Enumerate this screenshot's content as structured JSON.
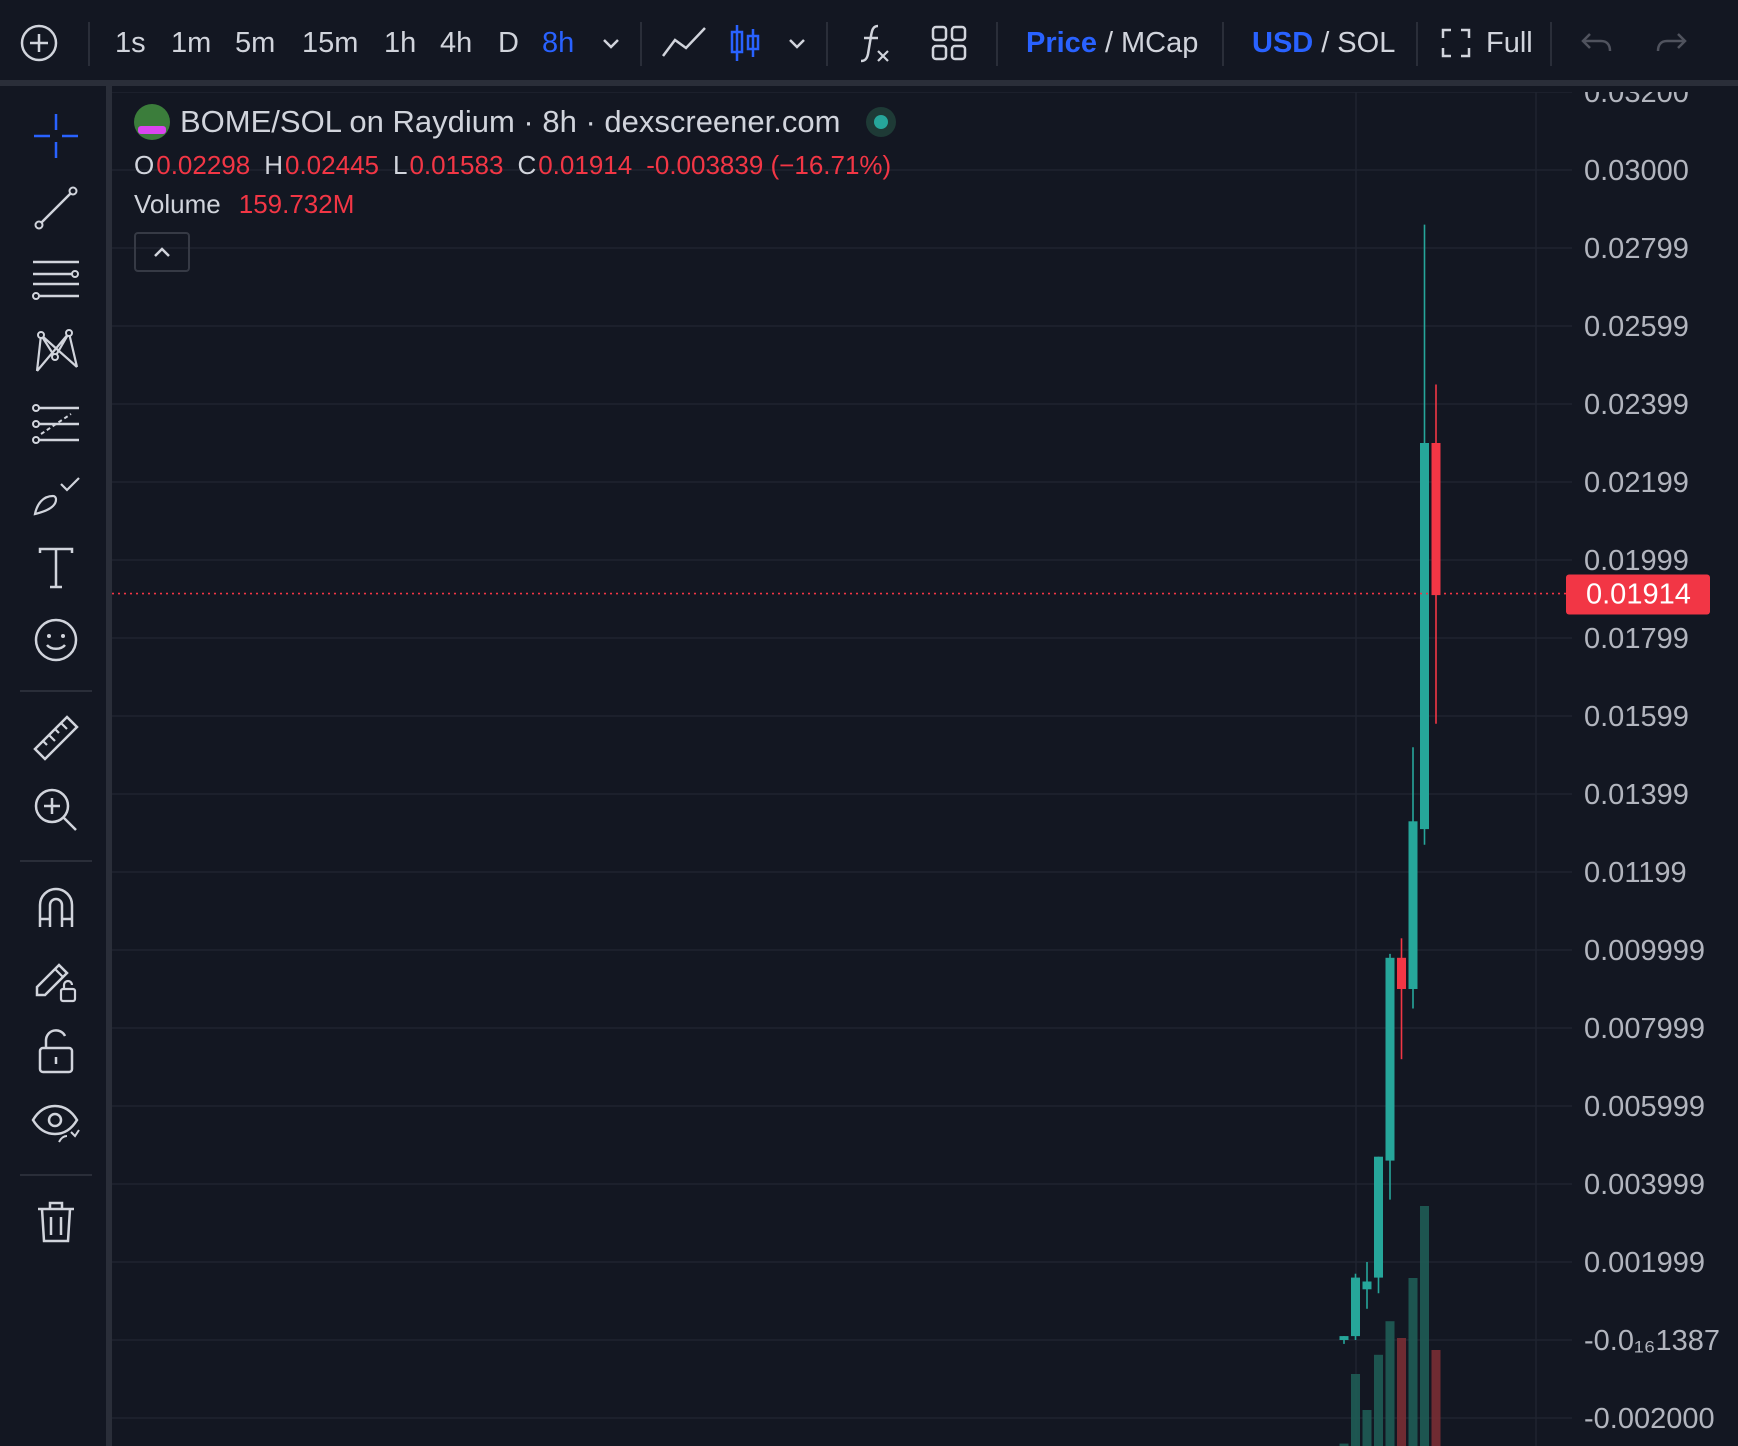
{
  "toolbar": {
    "intervals": [
      "1s",
      "1m",
      "5m",
      "15m",
      "1h",
      "4h",
      "D",
      "8h"
    ],
    "active_interval": "8h",
    "price_label": "Price",
    "mcap_label": "MCap",
    "usd_label": "USD",
    "sol_label": "SOL",
    "separator": "/",
    "full_label": "Full"
  },
  "legend": {
    "title": "BOME/SOL on Raydium · 8h · dexscreener.com",
    "o_key": "O",
    "o": "0.02298",
    "h_key": "H",
    "h": "0.02445",
    "l_key": "L",
    "l": "0.01583",
    "c_key": "C",
    "c": "0.01914",
    "change": "-0.003839 (−16.71%)",
    "volume_label": "Volume",
    "volume": "159.732M"
  },
  "colors": {
    "background": "#131722",
    "up": "#26a69a",
    "down": "#f23645",
    "accent": "#2962ff",
    "grid": "#1f2430"
  },
  "chart_data": {
    "type": "candlestick",
    "title": "BOME/SOL on Raydium · 8h · dexscreener.com",
    "y_ticks": [
      "0.03200",
      "0.03000",
      "0.02799",
      "0.02599",
      "0.02399",
      "0.02199",
      "0.01999",
      "0.01799",
      "0.01599",
      "0.01399",
      "0.01199",
      "0.009999",
      "0.007999",
      "0.005999",
      "0.003999",
      "0.001999",
      "-0.0₁₆1387",
      "-0.002000"
    ],
    "ylim": [
      -0.0021,
      0.0322
    ],
    "current_price": "0.01914",
    "candles": [
      {
        "o": 0.0,
        "h": 0.0001,
        "l": -0.0001,
        "c": 0.0001
      },
      {
        "o": 0.0001,
        "h": 0.0017,
        "l": 0.0,
        "c": 0.0016
      },
      {
        "o": 0.0013,
        "h": 0.002,
        "l": 0.0008,
        "c": 0.0015
      },
      {
        "o": 0.0016,
        "h": 0.0047,
        "l": 0.0012,
        "c": 0.0047
      },
      {
        "o": 0.0046,
        "h": 0.0099,
        "l": 0.0036,
        "c": 0.0098
      },
      {
        "o": 0.0098,
        "h": 0.0103,
        "l": 0.0072,
        "c": 0.009
      },
      {
        "o": 0.009,
        "h": 0.0152,
        "l": 0.0085,
        "c": 0.0133
      },
      {
        "o": 0.0131,
        "h": 0.0286,
        "l": 0.0127,
        "c": 0.023
      },
      {
        "o": 0.023,
        "h": 0.0245,
        "l": 0.0158,
        "c": 0.0191
      }
    ],
    "volume_rel": [
      0.01,
      0.3,
      0.15,
      0.38,
      0.52,
      0.45,
      0.7,
      1.0,
      0.4
    ],
    "volume": "159.732M"
  }
}
